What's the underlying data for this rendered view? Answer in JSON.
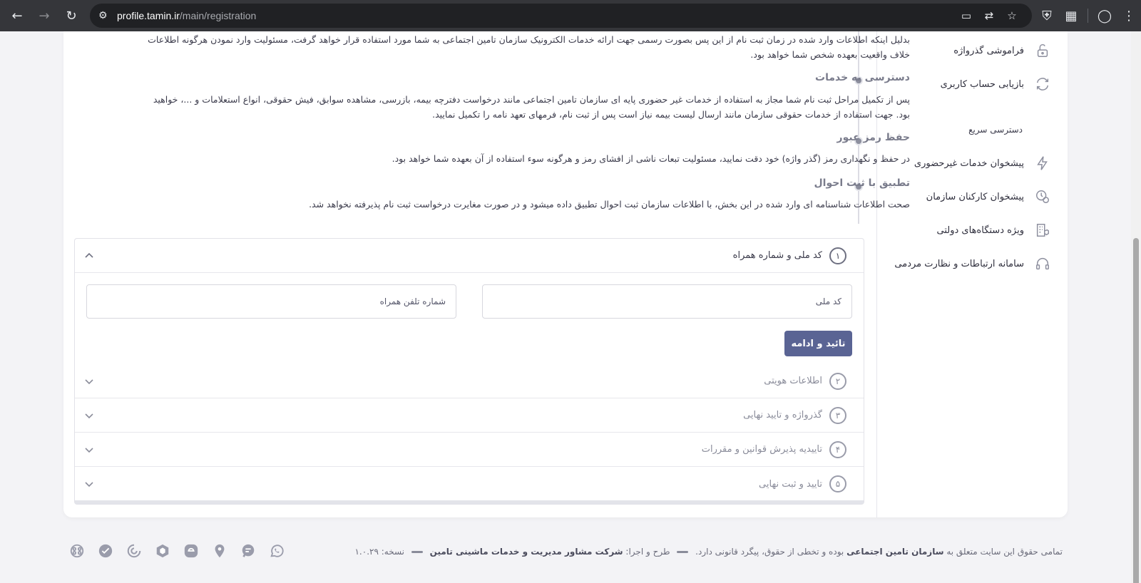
{
  "browser": {
    "url_host": "profile.tamin.ir",
    "url_path": "/main/registration"
  },
  "sidebar": {
    "items_top": [
      {
        "label": "فراموشی گذرواژه",
        "icon": "unlock-icon"
      },
      {
        "label": "بازیابی حساب کاربری",
        "icon": "refresh-icon"
      }
    ],
    "quick_access_heading": "دسترسی سریع",
    "items_quick": [
      {
        "label": "پیشخوان خدمات غیرحضوری",
        "icon": "flash-icon"
      },
      {
        "label": "پیشخوان کارکنان سازمان",
        "icon": "user-clock-icon"
      },
      {
        "label": "ویژه دستگاه‌های دولتی",
        "icon": "building-shield-icon"
      },
      {
        "label": "سامانه ارتباطات و نظارت مردمی",
        "icon": "headset-icon"
      }
    ]
  },
  "terms": {
    "intro_line1": "بدلیل اینکه اطلاعات وارد شده در زمان ثبت نام از این پس بصورت رسمی جهت ارائه خدمات الکترونیک سازمان تامین اجتماعی به شما مورد استفاده قرار خواهد گرفت، مسئولیت وارد نمودن هرگونه اطلاعات",
    "intro_line2": "خلاف واقعیت بعهده شخص شما خواهد بود.",
    "sections": [
      {
        "title": "دسترسی به خدمات",
        "lines": [
          "پس از تکمیل مراحل ثبت نام شما مجاز به استفاده از خدمات غیر حضوری پایه ای سازمان تامین اجتماعی مانند درخواست دفترچه بیمه، بازرسی، مشاهده سوابق، فیش حقوقی، انواع استعلامات و ...، خواهید",
          "بود. جهت استفاده از خدمات حقوقی سازمان مانند ارسال لیست بیمه نیاز است پس از ثبت نام، فرمهای تعهد نامه را تکمیل نمایید."
        ]
      },
      {
        "title": "حفظ رمز عبور",
        "lines": [
          "در حفظ و نگهداری رمز (گذر واژه) خود دقت نمایید، مسئولیت تبعات ناشی از افشای رمز و هرگونه سوء استفاده از آن بعهده شما خواهد بود."
        ]
      },
      {
        "title": "تطبیق با ثبت احوال",
        "lines": [
          "صحت اطلاعات شناسنامه ای وارد شده در این بخش، با اطلاعات سازمان ثبت احوال تطبیق داده میشود و در صورت مغایرت درخواست ثبت نام پذیرفته نخواهد شد."
        ]
      }
    ]
  },
  "steps": [
    {
      "number": "۱",
      "title": "کد ملی و شماره همراه",
      "expanded": true
    },
    {
      "number": "۲",
      "title": "اطلاعات هویتی",
      "expanded": false
    },
    {
      "number": "۳",
      "title": "گذرواژه و تایید نهایی",
      "expanded": false
    },
    {
      "number": "۴",
      "title": "تاییدیه پذیرش قوانین و مقررات",
      "expanded": false
    },
    {
      "number": "۵",
      "title": "تایید و ثبت نهایی",
      "expanded": false
    }
  ],
  "form": {
    "national_code_placeholder": "کد ملی",
    "mobile_placeholder": "شماره تلفن همراه",
    "submit_label": "تائید و ادامه",
    "submit_color": "#5a6494"
  },
  "footer": {
    "copy_prefix": "تمامی حقوق این سایت متعلق به",
    "copy_org": "سازمان تامین اجتماعی",
    "copy_suffix": "بوده و تخطی از حقوق، پیگرد قانونی دارد.",
    "design_prefix": "طرح و اجرا:",
    "design_company": "شرکت مشاور مدیریت و خدمات ماشینی تامین",
    "version_label": "نسخه:",
    "version": "۱.۰.۲۹",
    "socials": [
      "whatsapp-icon",
      "chat-icon",
      "location-icon",
      "eitaa-icon",
      "rubika-icon",
      "bale-icon",
      "telegram-icon",
      "aparat-icon"
    ]
  }
}
